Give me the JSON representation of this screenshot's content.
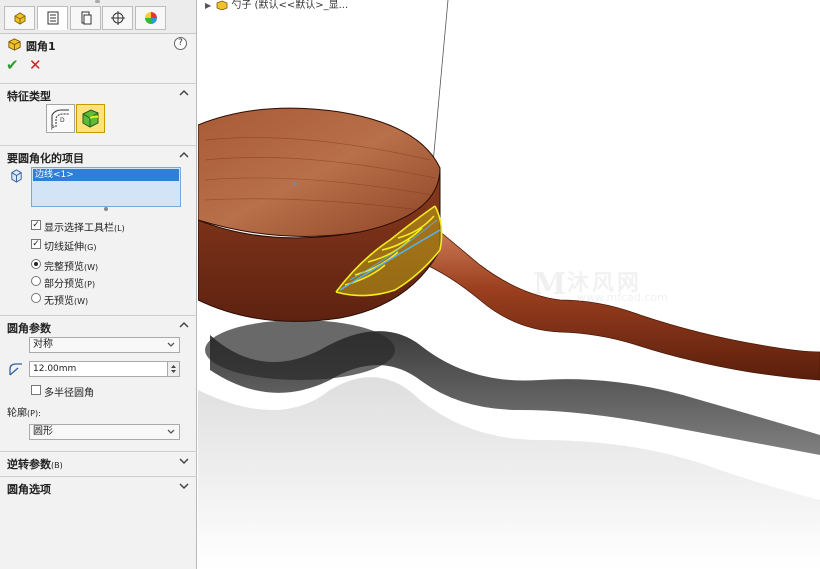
{
  "panel": {
    "tabs": [
      {
        "icon": "feature-manager-icon"
      },
      {
        "icon": "property-manager-icon"
      },
      {
        "icon": "configuration-manager-icon"
      },
      {
        "icon": "dimxpert-icon"
      },
      {
        "icon": "display-manager-icon"
      }
    ],
    "feature_title": "圆角1",
    "help_label": "?",
    "ok_symbol": "✔",
    "cancel_symbol": "✕",
    "sections": {
      "fillet_type": "特征类型",
      "items_to_fillet": "要圆角化的项目",
      "fillet_params": "圆角参数",
      "setback_params": "逆转参数",
      "setback_params_key": "(B)",
      "fillet_options": "圆角选项"
    },
    "selection_item": "边线<1>",
    "options": {
      "show_toolbar": {
        "label": "显示选择工具栏",
        "key": "(L)",
        "checked": true
      },
      "tangent_prop": {
        "label": "切线延伸",
        "key": "(G)",
        "checked": true
      },
      "full_preview": {
        "label": "完整预览",
        "key": "(W)",
        "selected": true
      },
      "partial_preview": {
        "label": "部分预览",
        "key": "(P)",
        "selected": false
      },
      "no_preview": {
        "label": "无预览",
        "key": "(W)",
        "selected": false
      }
    },
    "symmetric_value": "对称",
    "radius_value": "12.00mm",
    "multi_radius": {
      "label": "多半径圆角",
      "checked": false
    },
    "profile_label": "轮廓",
    "profile_key": "(P):",
    "profile_value": "圆形"
  },
  "viewport": {
    "tree_text": "勺子 (默认<<默认>_显...",
    "watermark_cn": "沐风网",
    "watermark_url": "www.mfcad.com",
    "watermark_logo": "M"
  },
  "colors": {
    "wood": "#8b3a1f",
    "wood_light": "#b56a44",
    "preview_yellow": "#f2ee1a",
    "preview_blue": "#4fb6ff",
    "selection_blue": "#2f7fd7"
  }
}
